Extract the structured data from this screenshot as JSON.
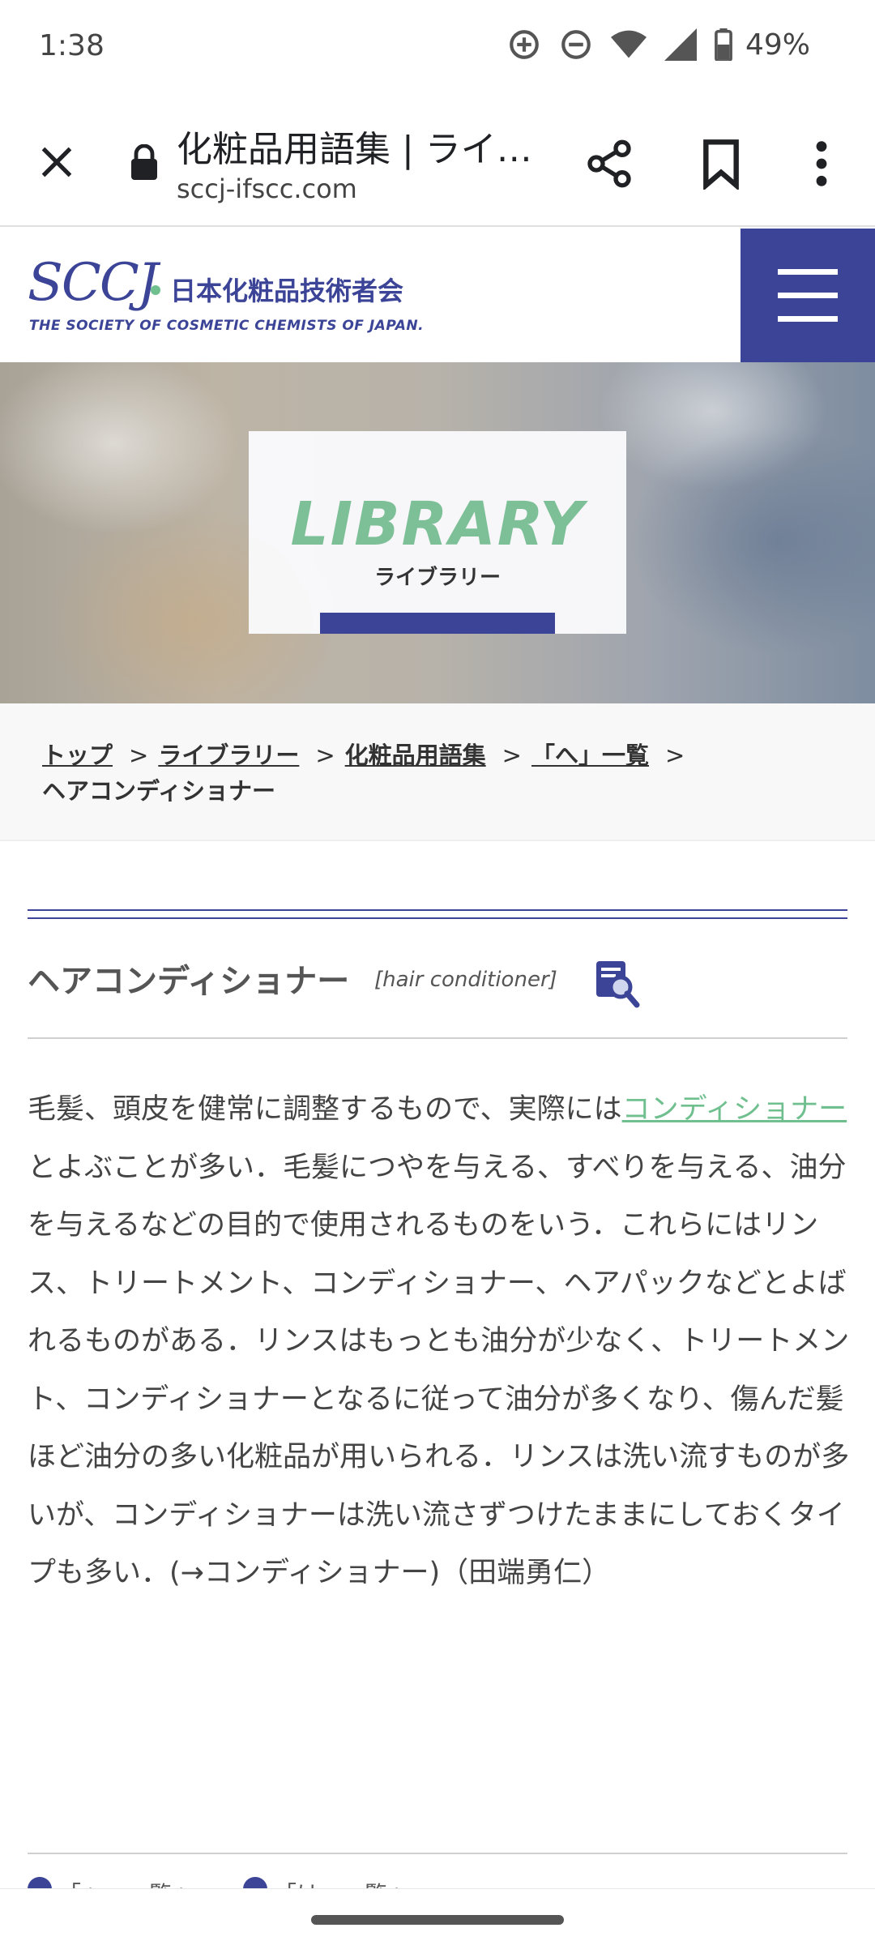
{
  "status_bar": {
    "time": "1:38",
    "battery": "49%",
    "icons": [
      "data-saver-icon",
      "dnd-icon",
      "wifi-icon",
      "signal-icon",
      "battery-icon"
    ]
  },
  "toolbar": {
    "title": "化粧品用語集 | ライ…",
    "url": "sccj-ifscc.com"
  },
  "site": {
    "logo_mark": "SCCJ",
    "logo_jp": "日本化粧品技術者会",
    "logo_en": "THE SOCIETY OF COSMETIC CHEMISTS OF JAPAN."
  },
  "hero": {
    "title": "LIBRARY",
    "subtitle": "ライブラリー"
  },
  "breadcrumb": {
    "items": [
      "トップ",
      "ライブラリー",
      "化粧品用語集",
      "「へ」一覧"
    ],
    "current": "ヘアコンディショナー",
    "separator": ">"
  },
  "entry": {
    "term_jp": "ヘアコンディショナー",
    "term_en": "[hair conditioner]",
    "body_before_link": "毛髪、頭皮を健常に調整するもので、実際には",
    "body_link": "コンディショナー",
    "body_after_link": "とよぶことが多い．毛髪につやを与える、すべりを与える、油分を与えるなどの目的で使用されるものをいう．これらにはリンス、トリートメント、コンディショナー、ヘアパックなどとよばれるものがある．リンスはもっとも油分が少なく、トリートメント、コンディショナーとなるに従って油分が多くなり、傷んだ髪ほど油分の多い化粧品が用いられる．リンスは洗い流すものが多いが、コンディショナーは洗い流さずつけたままにしておくタイプも多い．(→コンディショナー)（田端勇仁）"
  },
  "footer_peek": {
    "prev": "「へ」一覧へ",
    "next": "「は」一覧へ"
  },
  "colors": {
    "brand": "#3b4496",
    "accent": "#7dbf97",
    "link": "#6fbf8f"
  }
}
